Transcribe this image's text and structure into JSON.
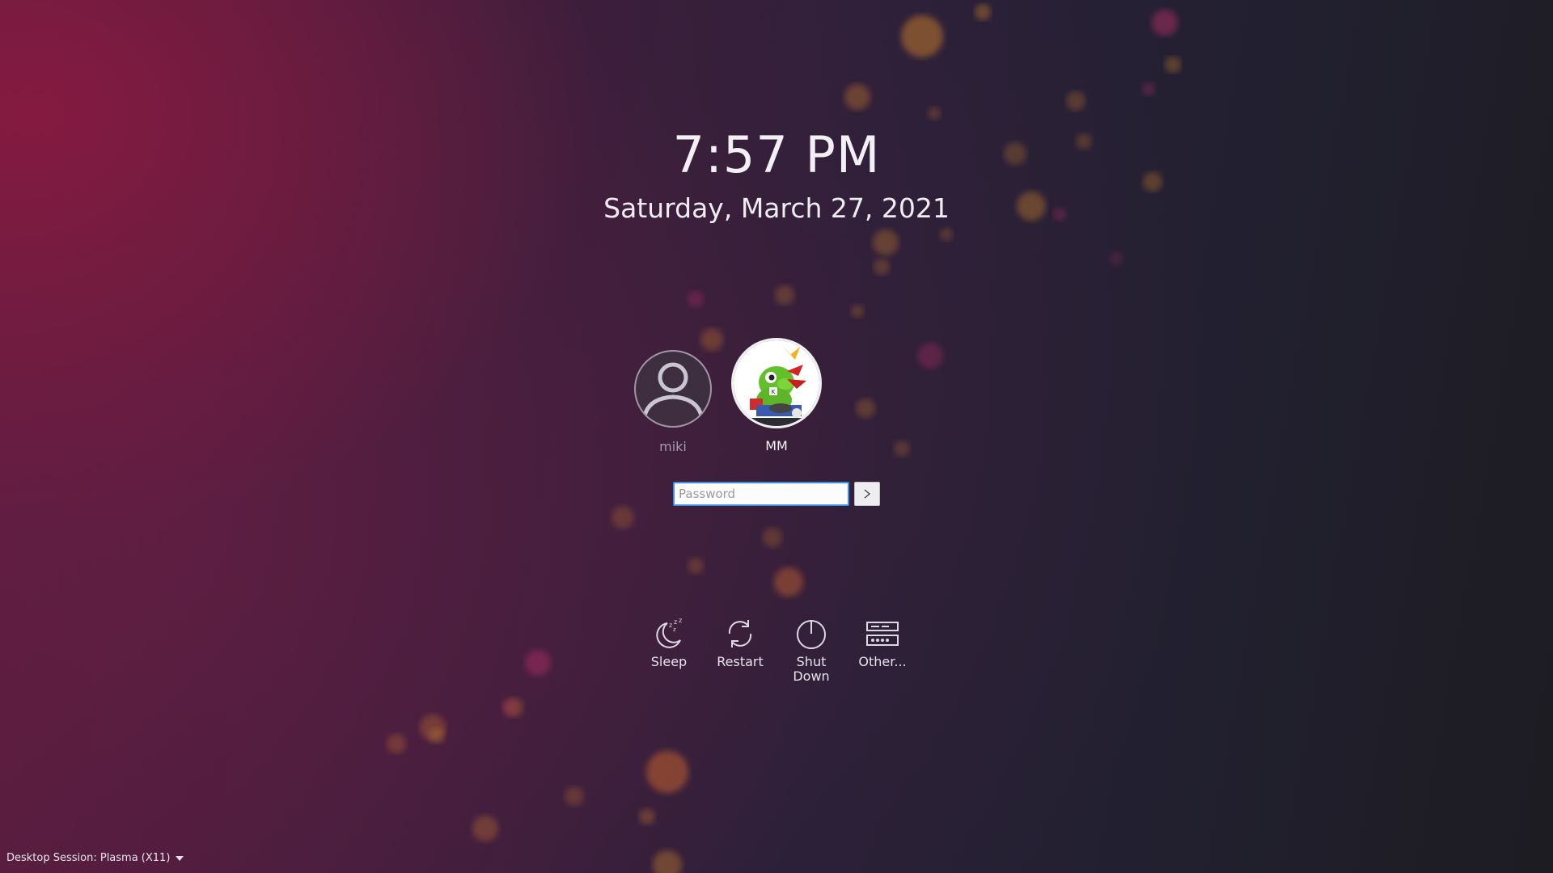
{
  "clock": {
    "time": "7:57 PM",
    "date": "Saturday, March 27, 2021"
  },
  "users": [
    {
      "name": "miki",
      "avatar_icon": "person-silhouette-icon",
      "selected": false
    },
    {
      "name": "MM",
      "avatar_icon": "konqi-dragon-avatar",
      "selected": true
    }
  ],
  "login": {
    "password_placeholder": "Password",
    "password_value": "",
    "submit_icon": "chevron-right-icon"
  },
  "actions": [
    {
      "label": "Sleep",
      "icon": "sleep-moon-icon"
    },
    {
      "label": "Restart",
      "icon": "restart-arrows-icon"
    },
    {
      "label": "Shut\nDown",
      "icon": "power-icon"
    },
    {
      "label": "Other...",
      "icon": "other-sessions-icon"
    }
  ],
  "session": {
    "label": "Desktop Session: Plasma (X11)",
    "dropdown_icon": "caret-down-icon"
  },
  "colors": {
    "accent": "#3d8ee6",
    "background_dark": "#24202f",
    "background_crimson": "#8c1a40"
  }
}
